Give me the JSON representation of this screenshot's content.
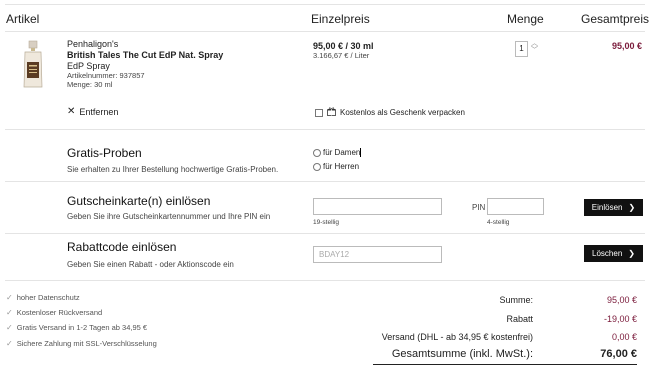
{
  "header": {
    "artikel": "Artikel",
    "einzelpreis": "Einzelpreis",
    "menge": "Menge",
    "gesamtpreis": "Gesamtpreis"
  },
  "product": {
    "brand": "Penhaligon's",
    "name": "British Tales The Cut EdP Nat. Spray",
    "type": "EdP Spray",
    "article_no": "Artikelnummer: 937857",
    "amount": "Menge: 30 ml",
    "price": "95,00 € / 30 ml",
    "price_per_liter": "3.166,67 € / Liter",
    "quantity": "1",
    "total": "95,00 €",
    "remove_label": "Entfernen",
    "gift_label": "Kostenlos als Geschenk verpacken"
  },
  "samples": {
    "title": "Gratis-Proben",
    "subtitle": "Sie erhalten zu Ihrer Bestellung hochwertige Gratis-Proben.",
    "option_women": "für Damen",
    "option_men": "für Herren"
  },
  "giftcard": {
    "title": "Gutscheinkarte(n) einlösen",
    "subtitle": "Geben Sie ihre Gutscheinkartennummer und Ihre PIN ein",
    "card_hint": "19-stellig",
    "pin_label": "PIN",
    "pin_hint": "4-stellig",
    "button": "Einlösen"
  },
  "coupon": {
    "title": "Rabattcode einlösen",
    "subtitle": "Geben Sie einen Rabatt - oder Aktionscode ein",
    "value": "BDAY12",
    "button": "Löschen"
  },
  "features": [
    "hoher Datenschutz",
    "Kostenloser Rückversand",
    "Gratis Versand in 1-2 Tagen ab 34,95 €",
    "Sichere Zahlung mit SSL-Verschlüsselung"
  ],
  "summary": {
    "summe_label": "Summe:",
    "summe_value": "95,00 €",
    "rabatt_label": "Rabatt",
    "rabatt_value": "-19,00 €",
    "versand_label": "Versand (DHL - ab 34,95 € kostenfrei)",
    "versand_value": "0,00 €",
    "total_label": "Gesamtsumme (inkl. MwSt.):",
    "total_value": "76,00 €"
  },
  "colors": {
    "accent": "#7a1a3a",
    "button": "#111111"
  }
}
